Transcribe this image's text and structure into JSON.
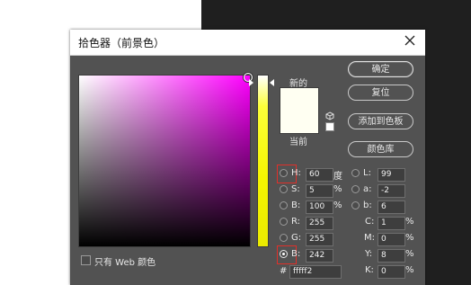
{
  "window": {
    "title": "拾色器（前景色）"
  },
  "swatch": {
    "new_label": "新的",
    "current_label": "当前",
    "new_color": "#fffff2",
    "current_color": "#fffff2"
  },
  "buttons": {
    "ok": "确定",
    "reset": "复位",
    "add_to_swatches": "添加到色板",
    "color_library": "颜色库"
  },
  "hsb": {
    "h": {
      "label": "H:",
      "value": "60",
      "unit": "度"
    },
    "s": {
      "label": "S:",
      "value": "5",
      "unit": "%"
    },
    "b": {
      "label": "B:",
      "value": "100",
      "unit": "%"
    }
  },
  "rgb": {
    "r": {
      "label": "R:",
      "value": "255"
    },
    "g": {
      "label": "G:",
      "value": "255"
    },
    "b": {
      "label": "B:",
      "value": "242"
    }
  },
  "lab": {
    "l": {
      "label": "L:",
      "value": "99"
    },
    "a": {
      "label": "a:",
      "value": "-2"
    },
    "b": {
      "label": "b:",
      "value": "6"
    }
  },
  "cmyk": {
    "c": {
      "label": "C:",
      "value": "1",
      "unit": "%"
    },
    "m": {
      "label": "M:",
      "value": "0",
      "unit": "%"
    },
    "y": {
      "label": "Y:",
      "value": "8",
      "unit": "%"
    },
    "k": {
      "label": "K:",
      "value": "0",
      "unit": "%"
    }
  },
  "hex": {
    "label": "#",
    "value": "fffff2"
  },
  "web_only": {
    "label": "只有 Web 颜色",
    "checked": false
  },
  "selected_channel": "B (RGB)",
  "colors": {
    "dialog_bg": "#525252",
    "highlight": "#e0302a"
  }
}
